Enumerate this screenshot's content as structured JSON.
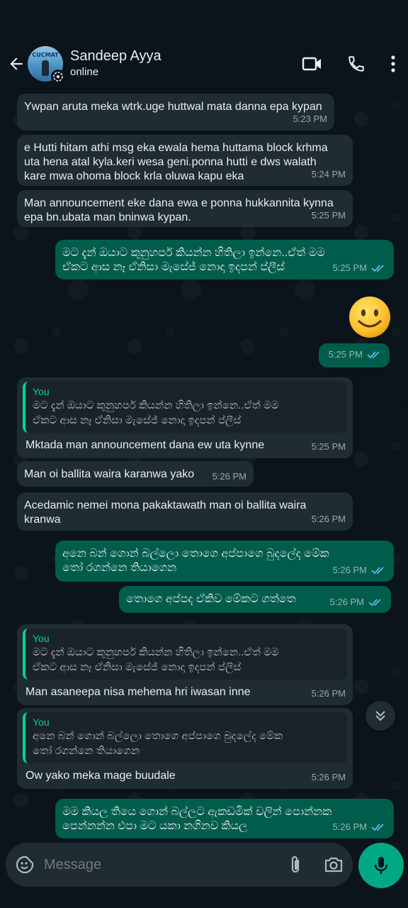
{
  "contact": {
    "name": "Sandeep Ayya",
    "status": "online",
    "avatar_text": "CUCMAT"
  },
  "messages": [
    {
      "dir": "in",
      "text": "Ywpan aruta meka wtrk.uge huttwal mata danna epa kypan",
      "time": "5:23 PM"
    },
    {
      "dir": "in",
      "text": "e Hutti hitam athi msg eka ewala hema huttama block krhma\nuta hena atal kyla.keri wesa geni.ponna hutti e dws walath\nkare mwa ohoma block krla oluwa kapu eka",
      "time": "5:24 PM"
    },
    {
      "dir": "in",
      "text": "Man announcement eke dana ewa e ponna hukkannita kynna\nepa bn.ubata man bninwa kypan.",
      "time": "5:25 PM"
    },
    {
      "dir": "out",
      "text": "මට දැන් ඔයාට කුනුහර්ප කියන්න හිතිලා ඉන්නෙ..ඒත් මම\nඒකට ආස නෑ ඒනිසා මැසේජ් නොදා ඉදපන් ප්ලීස්",
      "time": "5:25 PM"
    },
    {
      "dir": "out",
      "text": "",
      "time": "5:25 PM",
      "emoji": "slightly-smiling-face"
    },
    {
      "dir": "in",
      "quote": {
        "name": "You",
        "text": "මට දැන් ඔයාට කුනුහර්ප කියන්න හිතිලා ඉන්නෙ..ඒත් මම\nඒකට ආස නෑ ඒනිසා මැසේජ් නොදා ඉදපන් ප්ලීස්"
      },
      "text": "Mktada man announcement dana ew uta kynne",
      "time": "5:25 PM"
    },
    {
      "dir": "in",
      "text": "Man oi ballita waira karanwa yako",
      "time": "5:26 PM"
    },
    {
      "dir": "in",
      "text": "Acedamic nemei mona pakaktawath man oi ballita waira\nkranwa",
      "time": "5:26 PM"
    },
    {
      "dir": "out",
      "text": "අනෙ බන් ගොන් බල්ලො තොගෙ අප්පාගෙ බුදලේද මේක\nතෝ රගන්නෙ තියාගෙන",
      "time": "5:26 PM"
    },
    {
      "dir": "out",
      "text": "තොගෙ අප්පද ඒකිව මේකට ගත්තෙ",
      "time": "5:26 PM"
    },
    {
      "dir": "in",
      "quote": {
        "name": "You",
        "text": "මට දැන් ඔයාට කුනුහර්ප කියන්න හිතිලා ඉන්නෙ..ඒත් මම\nඒකට ආස නෑ ඒනිසා මැසේජ් නොදා ඉදපන් ප්ලීස්"
      },
      "text": "Man asaneepa nisa mehema hri iwasan inne",
      "time": "5:26 PM"
    },
    {
      "dir": "in",
      "quote": {
        "name": "You",
        "text": "අනෙ බන් ගොන් බල්ලො තොගෙ අප්පාගෙ බුදලේද මේක\nතෝ රගන්නෙ තියාගෙන"
      },
      "text": "Ow yako meka mage buudale",
      "time": "5:26 PM"
    },
    {
      "dir": "out",
      "text": "මම කියල තියෙ ගොන් බල්ලට ඇකඩමික් වලින් පොන්නක\nපෙන්නන්න එපා මට යකා නගිනව කියල",
      "time": "5:26 PM"
    }
  ],
  "composer": {
    "placeholder": "Message"
  },
  "colors": {
    "background": "#0b141a",
    "incoming_bubble": "#202c33",
    "outgoing_bubble": "#005c4b",
    "accent": "#00a884",
    "read_ticks": "#53bdeb",
    "quote_name": "#06cf9c"
  }
}
